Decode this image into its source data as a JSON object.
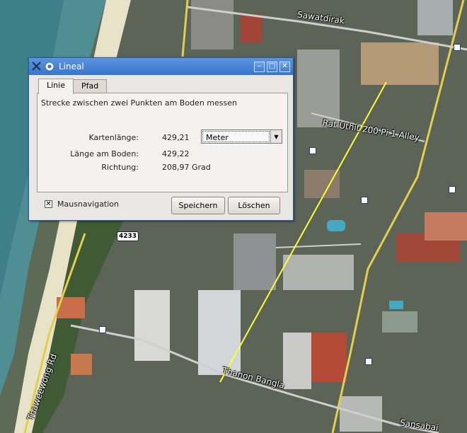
{
  "window": {
    "title": "Lineal",
    "min_glyph": "‒",
    "max_glyph": "□",
    "close_glyph": "✕"
  },
  "tabs": [
    {
      "label": "Linie",
      "active": true
    },
    {
      "label": "Pfad",
      "active": false
    }
  ],
  "panel": {
    "description": "Strecke zwischen zwei Punkten am Boden messen",
    "map_length_label": "Kartenlänge:",
    "map_length_value": "429,21",
    "ground_length_label": "Länge am Boden:",
    "ground_length_value": "429,22",
    "direction_label": "Richtung:",
    "direction_value": "208,97 Grad",
    "unit_select": {
      "selected": "Meter"
    }
  },
  "footer": {
    "mouse_nav_label": "Mausnavigation",
    "mouse_nav_checked": true,
    "save_label": "Speichern",
    "clear_label": "Löschen"
  },
  "map": {
    "labels": {
      "sawatdirak": "Sawatdirak",
      "rat_uthit": "Rat Uthit 200 Pi 1 Alley",
      "thanon_bangla": "Thanon Bangla",
      "thaweewong": "Thaweewong Rd",
      "sansabai": "Sansabai"
    },
    "route_shield": "4233",
    "colors": {
      "road": "#e3cf4c",
      "measure_line": "#ffff33",
      "title_bar": "#3a74c9"
    }
  }
}
